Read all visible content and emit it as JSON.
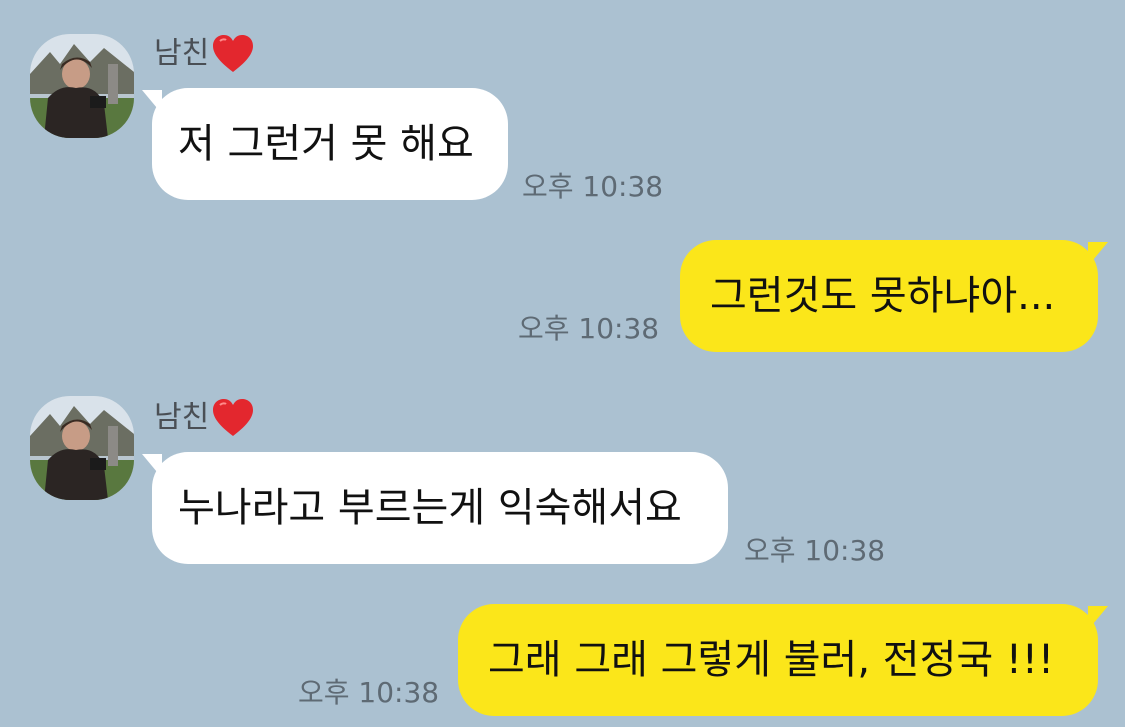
{
  "colors": {
    "background": "#abc1d1",
    "incoming_bubble": "#ffffff",
    "outgoing_bubble": "#fbe61a",
    "timestamp": "#5e6a74"
  },
  "messages": [
    {
      "direction": "incoming",
      "sender_name": "남친",
      "sender_emoji": "heart-icon",
      "text": "저 그런거 못 해요",
      "time": "오후 10:38"
    },
    {
      "direction": "outgoing",
      "text": "그런것도 못하냐아...",
      "time": "오후 10:38"
    },
    {
      "direction": "incoming",
      "sender_name": "남친",
      "sender_emoji": "heart-icon",
      "text": "누나라고 부르는게 익숙해서요",
      "time": "오후 10:38"
    },
    {
      "direction": "outgoing",
      "text": "그래 그래 그렇게 불러, 전정국 !!!",
      "time": "오후 10:38"
    }
  ]
}
